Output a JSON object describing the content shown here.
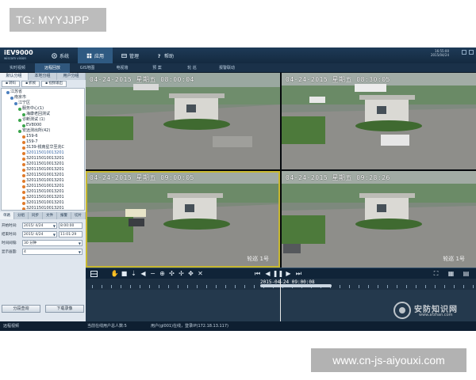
{
  "watermarks": {
    "top_left": "TG: MYYJJPP",
    "bottom_right": "www.cn-js-aiyouxi.com"
  },
  "app": {
    "logo_title": "iEV9000",
    "logo_subtitle": "wiscom vision",
    "menu": [
      {
        "label": "系统",
        "icon": "system-icon"
      },
      {
        "label": "应用",
        "icon": "grid-icon",
        "active": true
      },
      {
        "label": "管理",
        "icon": "manage-icon"
      },
      {
        "label": "帮助",
        "icon": "help-icon"
      }
    ],
    "clock_time": "16:55:00",
    "clock_date": "2015/04/24",
    "tabs": [
      {
        "label": "实时视频"
      },
      {
        "label": "远程回放",
        "active": true
      },
      {
        "label": "GIS地图"
      },
      {
        "label": "电视墙"
      },
      {
        "label": "预 案"
      },
      {
        "label": "轮 巡"
      },
      {
        "label": "报警联动"
      }
    ]
  },
  "left_panel": {
    "tabs": [
      "默认分组",
      "本地分组",
      "用户分组"
    ],
    "sub_buttons": [
      "转码",
      "抓帧",
      "视频输出"
    ],
    "tree": [
      {
        "label": "江苏省",
        "indent": 1,
        "color": "#4b7fbf"
      },
      {
        "label": "南京市",
        "indent": 2,
        "color": "#4b7fbf"
      },
      {
        "label": "江宁区",
        "indent": 3,
        "color": "#4b7fbf"
      },
      {
        "label": "服务中心(1)",
        "indent": 4,
        "color": "#3aa54b"
      },
      {
        "label": "海康老回测试",
        "indent": 5,
        "color": "#3aa54b"
      },
      {
        "label": "诊断测试 (1)",
        "indent": 4,
        "color": "#3aa54b"
      },
      {
        "label": "EV8000",
        "indent": 5,
        "color": "#3aa54b"
      },
      {
        "label": "安远测出所(42)",
        "indent": 4,
        "color": "#3aa54b"
      },
      {
        "label": "159-6",
        "indent": 5,
        "color": "#e07a2a"
      },
      {
        "label": "159-7",
        "indent": 5,
        "color": "#e07a2a"
      },
      {
        "label": "3139-锐南星华至兆C",
        "indent": 5,
        "color": "#e07a2a"
      },
      {
        "label": "320115010013201",
        "indent": 5,
        "color": "#e07a2a",
        "hl": true
      },
      {
        "label": "320115010013201",
        "indent": 5,
        "color": "#e07a2a"
      },
      {
        "label": "320115010013201",
        "indent": 5,
        "color": "#e07a2a"
      },
      {
        "label": "320115010013201",
        "indent": 5,
        "color": "#e07a2a"
      },
      {
        "label": "320115010013201",
        "indent": 5,
        "color": "#e07a2a"
      },
      {
        "label": "320115010013201",
        "indent": 5,
        "color": "#e07a2a"
      },
      {
        "label": "320115010013201",
        "indent": 5,
        "color": "#e07a2a"
      },
      {
        "label": "320115010013201",
        "indent": 5,
        "color": "#e07a2a"
      },
      {
        "label": "320115010013201",
        "indent": 5,
        "color": "#e07a2a"
      },
      {
        "label": "320115010013201",
        "indent": 5,
        "color": "#e07a2a"
      },
      {
        "label": "320115010013201",
        "indent": 5,
        "color": "#e07a2a"
      }
    ],
    "tabs2": [
      "单路",
      "分组",
      "同步",
      "文件",
      "报警",
      "切片"
    ],
    "start_label": "开始时间:",
    "start_date": "2015/ 4/24",
    "start_time": "8:00:00",
    "end_label": "结束时间:",
    "end_date": "2015/ 4/24",
    "end_time": "11:01:29",
    "interval_label": "时间间隔:",
    "interval_value": "30 分钟",
    "display_label": "显示画面:",
    "display_value": "4",
    "btn_query": "分段查询",
    "btn_download": "下载录像"
  },
  "videos": [
    {
      "osd": "04-24-2015 星期五 08:00:04",
      "corner": ""
    },
    {
      "osd": "04-24-2015 星期五 08:30:05",
      "corner": ""
    },
    {
      "osd": "04-24-2015 星期五 09:00:05",
      "corner": "轮巡 1号"
    },
    {
      "osd": "04-24-2015 星期五 09:28:26",
      "corner": "轮巡 1号"
    }
  ],
  "timeline": {
    "label": "2015-04-24 09:00:08"
  },
  "status": {
    "left": "远程视频",
    "online": "当前在线用户总人数:5",
    "user": "用户(gl001)在线，登录IP(172.18.13.117)"
  },
  "brand": {
    "text": "安防知识网",
    "url": "www.afzhan.com"
  }
}
